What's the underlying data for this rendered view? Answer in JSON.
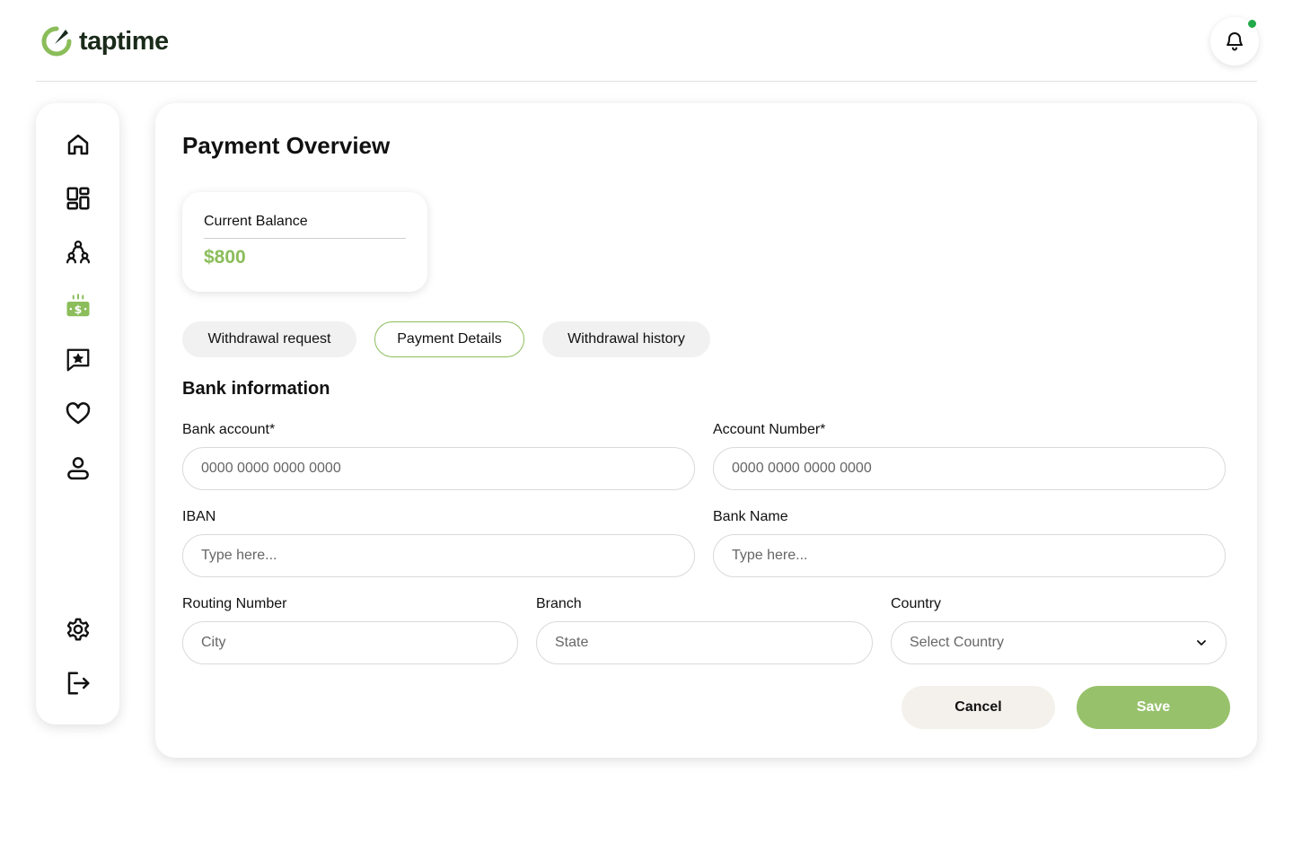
{
  "brand": {
    "name": "taptime",
    "accent": "#8bbd5a",
    "logo_dark": "#1a2a1a"
  },
  "header": {
    "notification_icon": "bell-icon",
    "notification_dot_color": "#22a94a"
  },
  "sidebar": {
    "items": [
      {
        "icon": "home-icon"
      },
      {
        "icon": "dashboard-grid-icon"
      },
      {
        "icon": "team-icon"
      },
      {
        "icon": "payment-money-icon",
        "active": true
      },
      {
        "icon": "review-star-chat-icon"
      },
      {
        "icon": "heart-icon"
      },
      {
        "icon": "profile-icon"
      },
      {
        "icon": "settings-gear-icon"
      },
      {
        "icon": "logout-icon"
      }
    ]
  },
  "main": {
    "title": "Payment Overview",
    "balance": {
      "label": "Current Balance",
      "value": "$800"
    },
    "tabs": [
      {
        "label": "Withdrawal request",
        "active": false
      },
      {
        "label": "Payment Details",
        "active": true
      },
      {
        "label": "Withdrawal history",
        "active": false
      }
    ],
    "section_title": "Bank information",
    "fields": {
      "bank_account": {
        "label": "Bank account*",
        "placeholder": "0000 0000 0000 0000"
      },
      "account_number": {
        "label": "Account Number*",
        "placeholder": "0000 0000 0000 0000"
      },
      "iban": {
        "label": "IBAN",
        "placeholder": "Type here..."
      },
      "bank_name": {
        "label": "Bank Name",
        "placeholder": "Type here..."
      },
      "routing_number": {
        "label": "Routing Number",
        "placeholder": "City"
      },
      "branch": {
        "label": "Branch",
        "placeholder": "State"
      },
      "country": {
        "label": "Country",
        "placeholder": "Select Country"
      }
    },
    "actions": {
      "cancel": "Cancel",
      "save": "Save"
    }
  }
}
